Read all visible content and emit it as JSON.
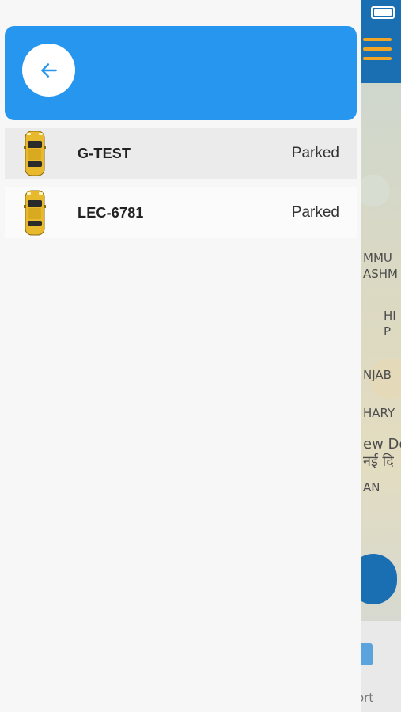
{
  "colors": {
    "header": "#2696ef",
    "back_arrow": "#2696ef",
    "car_body": "#e8b92c",
    "map_topbar": "#1a6fb3",
    "menu_accent": "#f0a526"
  },
  "header": {
    "back_icon": "arrow-left-icon"
  },
  "vehicles": [
    {
      "name": "G-TEST",
      "status": "Parked",
      "icon": "car-icon"
    },
    {
      "name": "LEC-6781",
      "status": "Parked",
      "icon": "car-icon"
    }
  ],
  "background_app": {
    "menu_icon": "hamburger-icon",
    "map_labels": [
      "MMU",
      "ASHM",
      "HI",
      "P",
      "NJAB",
      "HARY",
      "ew De",
      "नई दि",
      "AN"
    ],
    "bottom_label": "ort"
  }
}
